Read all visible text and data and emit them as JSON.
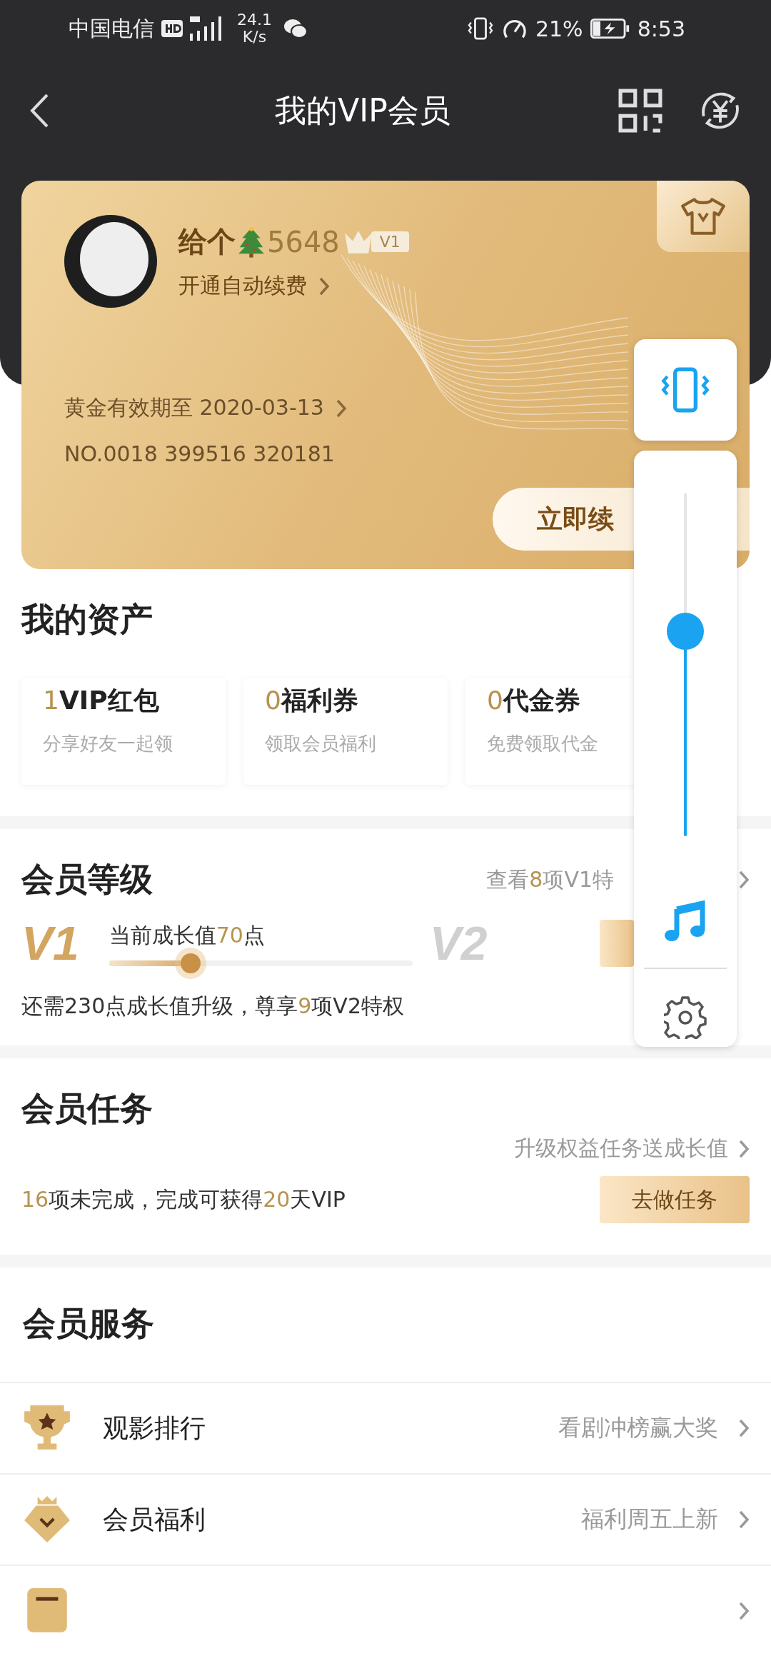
{
  "status_bar": {
    "carrier": "中国电信",
    "speed_value": "24.1",
    "speed_unit": "K/s",
    "battery": "21%",
    "time": "8:53"
  },
  "header": {
    "title": "我的VIP会员"
  },
  "member_card": {
    "name_prefix": "给个",
    "name_suffix": "5648",
    "level_badge": "V1",
    "auto_renew_link": "开通自动续费",
    "expiry_link": "黄金有效期至 2020-03-13",
    "card_number": "NO.0018 399516 320181",
    "renew_button": "立即续"
  },
  "assets": {
    "title": "我的资产",
    "items": [
      {
        "count": "1",
        "label": "VIP红包",
        "desc": "分享好友一起领"
      },
      {
        "count": "0",
        "label": "福利券",
        "desc": "领取会员福利"
      },
      {
        "count": "0",
        "label": "代金券",
        "desc": "免费领取代金"
      }
    ]
  },
  "level": {
    "title": "会员等级",
    "privilege_link": [
      {
        "text": "查看",
        "highlight": false
      },
      {
        "text": "8",
        "highlight": true
      },
      {
        "text": "项V1特",
        "highlight": false
      }
    ],
    "current_label": "V1",
    "next_label": "V2",
    "growth": [
      {
        "text": "当前成长值",
        "highlight": false
      },
      {
        "text": "70",
        "highlight": true
      },
      {
        "text": "点",
        "highlight": false
      }
    ],
    "progress": {
      "level": 0.27
    },
    "upgrade_note": [
      {
        "text": "还需230点成长值升级，尊享",
        "highlight": false
      },
      {
        "text": "9",
        "highlight": true
      },
      {
        "text": "项V2特权",
        "highlight": false
      }
    ]
  },
  "tasks": {
    "title": "会员任务",
    "link": "升级权益任务送成长值",
    "summary": [
      {
        "text": "16",
        "highlight": true
      },
      {
        "text": "项未完成，完成可获得",
        "highlight": false
      },
      {
        "text": "20",
        "highlight": true
      },
      {
        "text": "天VIP",
        "highlight": false
      }
    ],
    "button": "去做任务"
  },
  "services": {
    "title": "会员服务",
    "items": [
      {
        "kind": "trophy",
        "label": "观影排行",
        "hint": "看剧冲榜赢大奖"
      },
      {
        "kind": "crown",
        "label": "会员福利",
        "hint": "福利周五上新"
      },
      {
        "kind": "card"
      }
    ]
  },
  "volume_panel": {
    "level": 0.54
  }
}
